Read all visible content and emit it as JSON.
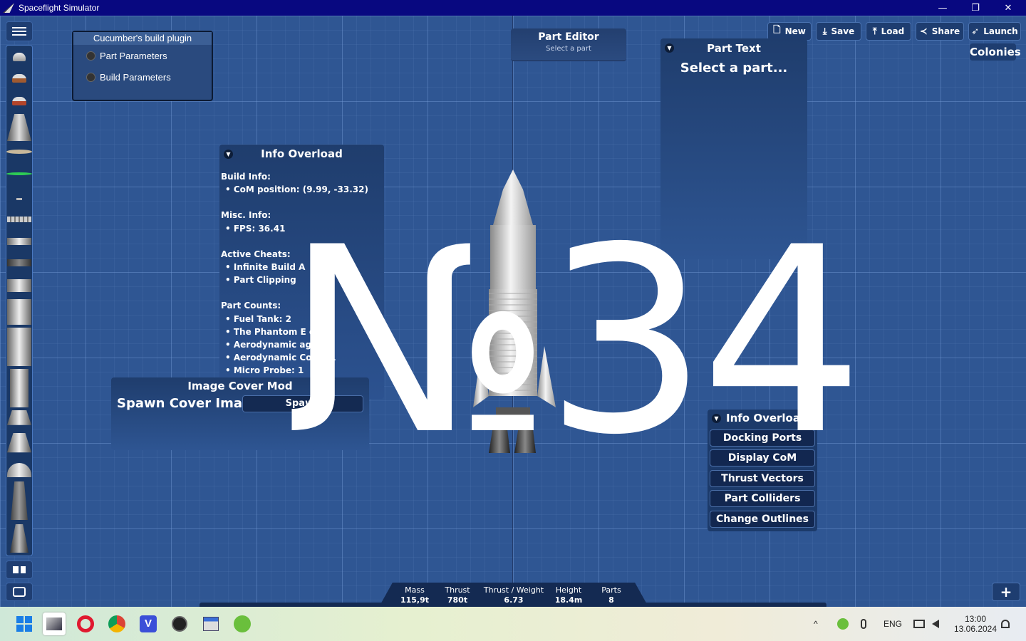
{
  "window": {
    "title": "Spaceflight Simulator",
    "minimize": "—",
    "restore": "❐",
    "close": "✕"
  },
  "plugin": {
    "title": "Cucumber's build plugin",
    "items": [
      "Part Parameters",
      "Build Parameters"
    ]
  },
  "part_editor": {
    "title": "Part Editor",
    "subtitle": "Select a part"
  },
  "toolbar": {
    "new": "New",
    "save": "Save",
    "load": "Load",
    "share": "Share",
    "launch": "Launch",
    "colonies": "Colonies"
  },
  "part_text": {
    "title": "Part Text",
    "body": "Select a part..."
  },
  "info_overload": {
    "title": "Info Overload",
    "build_info_label": "Build Info:",
    "com_position": "•  CoM position: (9.99, -33.32)",
    "misc_label": "Misc. Info:",
    "fps": "•  FPS: 36.41",
    "cheats_label": "Active Cheats:",
    "cheat1": "•  Infinite Build A",
    "cheat2": "•  Part Clipping",
    "counts_label": "Part Counts:",
    "count1": "•  Fuel Tank: 2",
    "count2": "•  The Phantom E         e: 2",
    "count3": "•  Aerodynamic          age: 2",
    "count4": "•  Aerodynamic          Cone: 1",
    "count5": "•  Micro Probe: 1"
  },
  "cover_mod": {
    "title": "Image Cover Mod",
    "label": "Spawn Cover Image",
    "button": "Spawn"
  },
  "overload_menu": {
    "title": "Info Overload",
    "buttons": [
      "Docking Ports",
      "Display CoM",
      "Thrust Vectors",
      "Part Colliders",
      "Change Outlines"
    ]
  },
  "overlay": {
    "text": "№34"
  },
  "stats": [
    {
      "label": "Mass",
      "value": "115,9t"
    },
    {
      "label": "Thrust",
      "value": "780t"
    },
    {
      "label": "Thrust / Weight",
      "value": "6.73"
    },
    {
      "label": "Height",
      "value": "18.4m"
    },
    {
      "label": "Parts",
      "value": "8"
    }
  ],
  "plus": "+",
  "taskbar": {
    "lang": "ENG",
    "time": "13:00",
    "date": "13.06.2024",
    "chevron": "^"
  }
}
